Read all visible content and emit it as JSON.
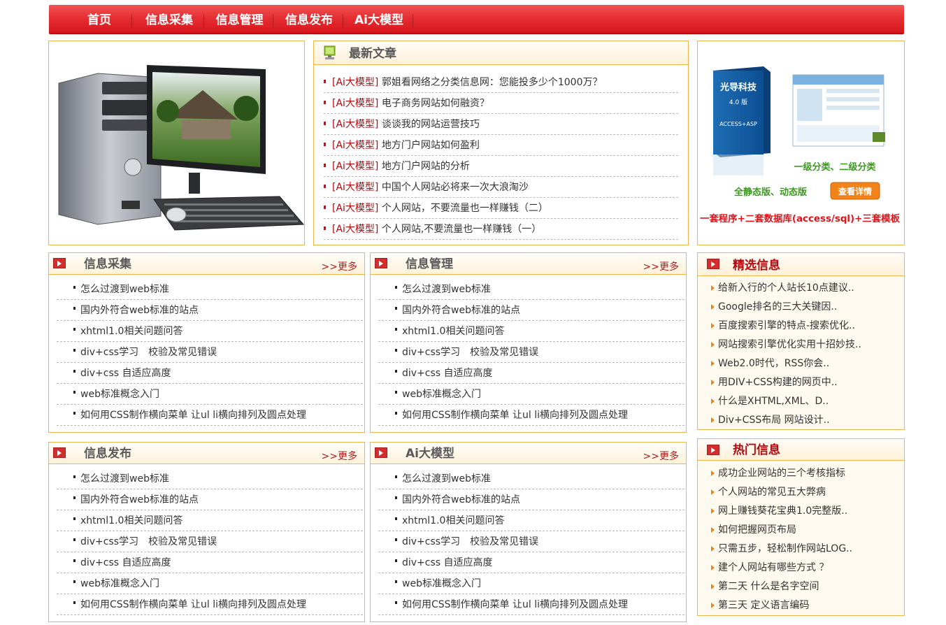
{
  "nav": {
    "items": [
      "首页",
      "信息采集",
      "信息管理",
      "信息发布",
      "Ai大模型"
    ]
  },
  "latest": {
    "title": "最新文章",
    "items": [
      {
        "tag": "[Ai大模型]",
        "text": "郭姐看网络之分类信息网：您能投多少个1000万？"
      },
      {
        "tag": "[Ai大模型]",
        "text": "电子商务网站如何融资？"
      },
      {
        "tag": "[Ai大模型]",
        "text": "谈谈我的网站运营技巧"
      },
      {
        "tag": "[Ai大模型]",
        "text": "地方门户网站如何盈利"
      },
      {
        "tag": "[Ai大模型]",
        "text": "地方门户网站的分析"
      },
      {
        "tag": "[Ai大模型]",
        "text": "中国个人网站必将来一次大浪淘沙"
      },
      {
        "tag": "[Ai大模型]",
        "text": "个人网站，不要流量也一样赚钱（二）"
      },
      {
        "tag": "[Ai大模型]",
        "text": "个人网站,不要流量也一样赚钱（一）"
      }
    ]
  },
  "ad": {
    "brand": "光导科技",
    "version": "4.0 版",
    "db": "ACCESS+ASP",
    "cat": "一级分类、二级分类",
    "modes": "全静态版、动态版",
    "btn": "查看详情",
    "slogan": "一套程序+二套数据库(access/sql)+三套模板"
  },
  "more_label": ">>更多",
  "common_items": [
    "怎么过渡到web标准",
    "国内外符合web标准的站点",
    "xhtml1.0相关问题问答",
    "div+css学习　校验及常见错误",
    "div+css 自适应高度",
    "web标准概念入门",
    "如何用CSS制作横向菜单 让ul li横向排列及圆点处理"
  ],
  "sections": [
    "信息采集",
    "信息管理",
    "信息发布",
    "Ai大模型"
  ],
  "featured": {
    "title": "精选信息",
    "items": [
      "给新入行的个人站长10点建议..",
      "Google排名的三大关键因..",
      "百度搜索引擎的特点-搜索优化..",
      "网站搜索引擎优化实用十招妙技..",
      "Web2.0时代，RSS你会..",
      "用DIV+CSS构建的网页中..",
      "什么是XHTML,XML、D..",
      "Div+CSS布局 网站设计.."
    ]
  },
  "hot": {
    "title": "热门信息",
    "items": [
      "成功企业网站的三个考核指标",
      "个人网站的常见五大弊病",
      "网上赚钱葵花宝典1.0完整版..",
      "如何把握网页布局",
      "只需五步，轻松制作网站LOG..",
      "建个人网站有哪些方式 ？",
      "第二天 什么是名字空间",
      "第三天 定义语言编码"
    ]
  },
  "colors": {
    "nav_red": "#e62f33",
    "border": "#f0b64c",
    "dot_red": "#e60012",
    "arrow": "#e8861a"
  }
}
